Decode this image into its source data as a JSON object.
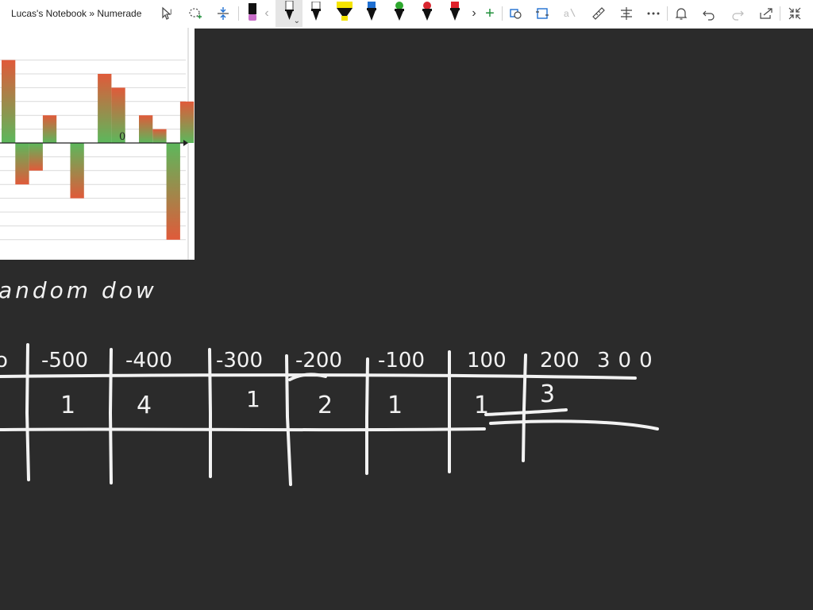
{
  "window": {
    "title": "Lucas's Notebook » Numerade"
  },
  "toolbar": {
    "tools": [
      {
        "name": "select-text-icon"
      },
      {
        "name": "lasso-select-icon"
      },
      {
        "name": "insert-space-icon"
      },
      {
        "name": "eraser-icon"
      },
      {
        "name": "pen-black-icon"
      },
      {
        "name": "pen-dark-icon"
      },
      {
        "name": "highlighter-yellow-icon"
      },
      {
        "name": "pen-blue-icon"
      },
      {
        "name": "pen-green-icon"
      },
      {
        "name": "pen-red-icon"
      },
      {
        "name": "pen-red2-icon"
      }
    ],
    "colors": {
      "eraser": "#c86dc8",
      "yellow": "#f5e400",
      "blue": "#1f6fd1",
      "green": "#2ea82e",
      "red": "#d8262f",
      "red2": "#e0202a",
      "accent": "#1f8f3a"
    },
    "pen_selected_chevron": "⌄",
    "scroll_left": "‹",
    "scroll_right": "›",
    "add": "+"
  },
  "chart_data": {
    "type": "bar",
    "title": "",
    "xlabel": "",
    "ylabel": "",
    "zero_label": "0",
    "ylim": [
      -7,
      6
    ],
    "values": [
      6,
      -3,
      -2,
      2,
      0,
      -4,
      0,
      5,
      4,
      0,
      2,
      1,
      -7,
      3
    ],
    "gradient": {
      "top": "#e05a3a",
      "bottom": "#5cb85c"
    }
  },
  "handwriting": {
    "heading": "andom dow",
    "header_cells": [
      "o",
      "-500",
      "-400",
      "-300",
      "-200",
      "-100",
      "100",
      "200",
      "300"
    ],
    "count_cells": [
      "1",
      "4",
      "1",
      "2",
      "1",
      "1",
      "3"
    ]
  }
}
